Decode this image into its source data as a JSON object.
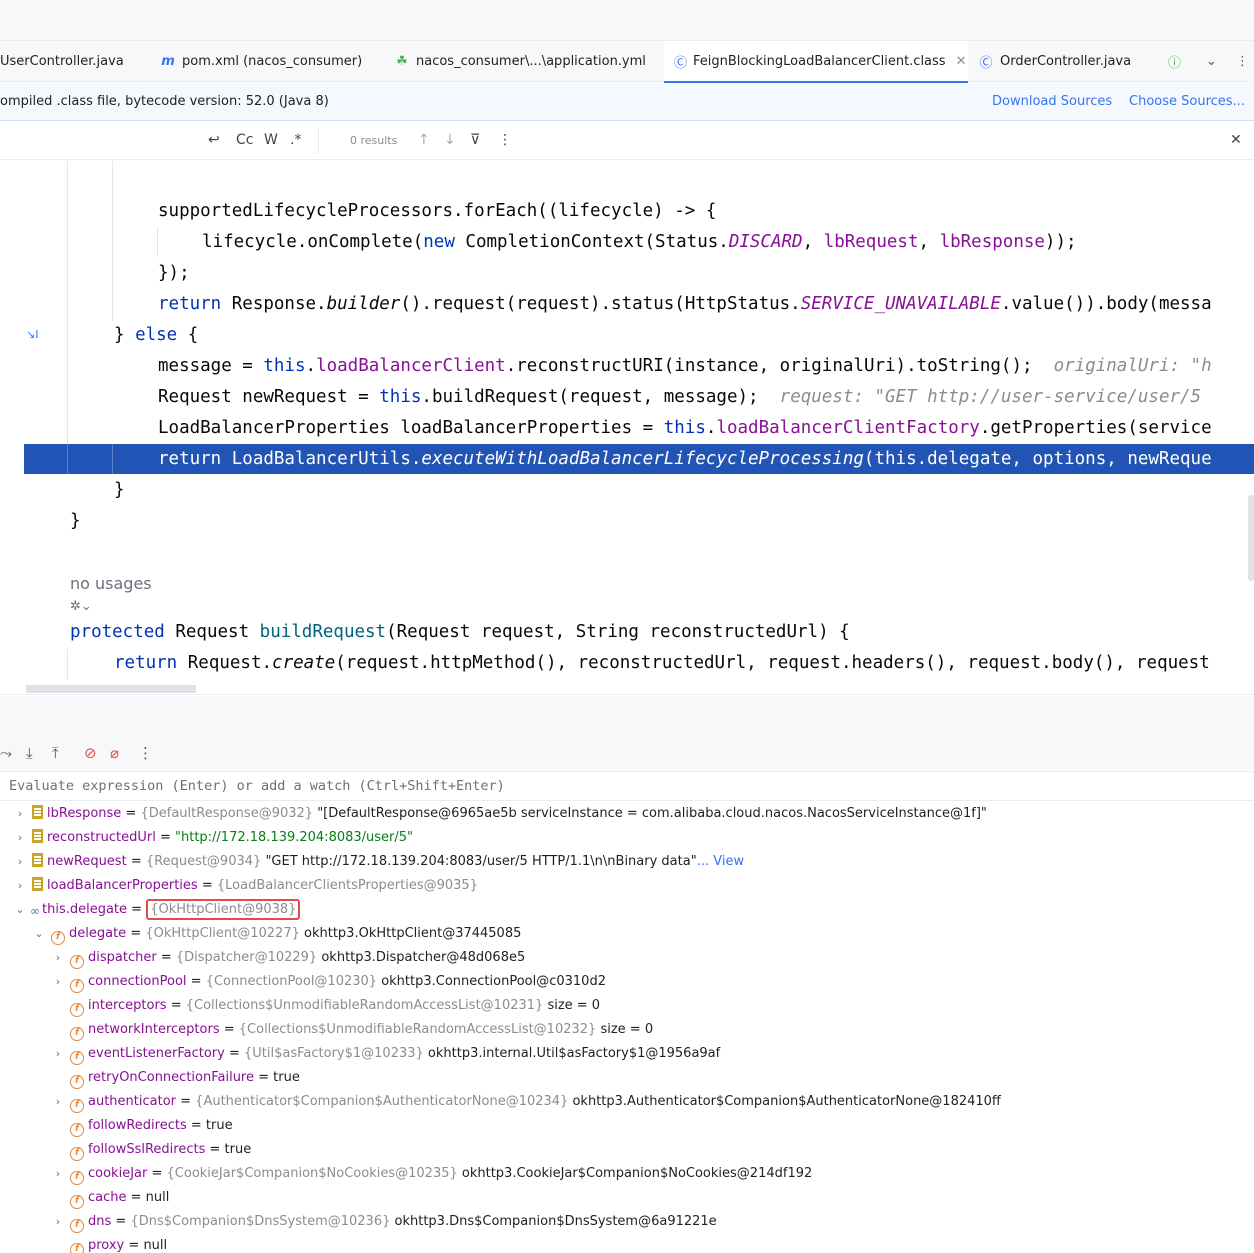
{
  "tabs": [
    {
      "label": "UserController.java",
      "icon": "java-class-icon"
    },
    {
      "label": "pom.xml (nacos_consumer)",
      "icon": "maven-icon"
    },
    {
      "label": "nacos_consumer\\...\\application.yml",
      "icon": "yaml-icon"
    },
    {
      "label": "FeignBlockingLoadBalancerClient.class",
      "icon": "class-icon",
      "active": true
    },
    {
      "label": "OrderController.java",
      "icon": "class-icon"
    }
  ],
  "notice": {
    "message": "ompiled .class file, bytecode version: 52.0 (Java 8)",
    "download_sources": "Download Sources",
    "choose_sources": "Choose Sources..."
  },
  "find": {
    "match_case": "Cc",
    "words": "W",
    "regex": ".*",
    "results": "0 results"
  },
  "code": {
    "l1_a": "supportedLifecycleProcessors.forEach((lifecycle) -> {",
    "l2_a": "lifecycle.onComplete(",
    "l2_new": "new",
    "l2_b": " CompletionContext(Status.",
    "l2_discard": "DISCARD",
    "l2_c": ", ",
    "l2_lbreq": "lbRequest",
    "l2_d": ", ",
    "l2_lbresp": "lbResponse",
    "l2_e": "));",
    "l3": "});",
    "l4_return": "return",
    "l4_a": " Response.",
    "l4_builder": "builder",
    "l4_b": "().request(request).status(HttpStatus.",
    "l4_su": "SERVICE_UNAVAILABLE",
    "l4_c": ".value()).body(messa",
    "l5_a": "} ",
    "l5_else": "else",
    "l5_b": " {",
    "l6_a": "message = ",
    "l6_this": "this",
    "l6_b": ".",
    "l6_lbc": "loadBalancerClient",
    "l6_c": ".reconstructURI(instance, originalUri).toString();",
    "l6_hint": "originalUri: \"h",
    "l7_a": "Request newRequest = ",
    "l7_this": "this",
    "l7_b": ".buildRequest(request, message);",
    "l7_hint": "request: \"GET http://user-service/user/5",
    "l8_a": "LoadBalancerProperties loadBalancerProperties = ",
    "l8_this": "this",
    "l8_b": ".",
    "l8_lbcf": "loadBalancerClientFactory",
    "l8_c": ".getProperties(service",
    "l9_return": "return",
    "l9_a": " LoadBalancerUtils.",
    "l9_exec": "executeWithLoadBalancerLifecycleProcessing",
    "l9_b": "(this.delegate, options, newReque",
    "l10": "}",
    "l11": "}",
    "no_usages": "no usages",
    "l12_protected": "protected",
    "l12_a": " Request ",
    "l12_build": "buildRequest",
    "l12_b": "(Request request, String reconstructedUrl) {",
    "l13_return": "return",
    "l13_a": " Request.",
    "l13_create": "create",
    "l13_b": "(request.httpMethod(), reconstructedUrl, request.headers(), request.body(), request"
  },
  "eval_placeholder": "Evaluate expression (Enter) or add a watch (Ctrl+Shift+Enter)",
  "variables": [
    {
      "indent": 0,
      "arrow": "›",
      "icon": "db",
      "name": "lbResponse",
      "type": "{DefaultResponse@9032}",
      "value": "\"[DefaultResponse@6965ae5b serviceInstance = com.alibaba.cloud.nacos.NacosServiceInstance@1f]\""
    },
    {
      "indent": 0,
      "arrow": "›",
      "icon": "db",
      "name": "reconstructedUrl",
      "type": "",
      "str": "\"http://172.18.139.204:8083/user/5\""
    },
    {
      "indent": 0,
      "arrow": "›",
      "icon": "db",
      "name": "newRequest",
      "type": "{Request@9034}",
      "value": "\"GET http://172.18.139.204:8083/user/5 HTTP/1.1\\n\\nBinary data\"",
      "link": "... View"
    },
    {
      "indent": 0,
      "arrow": "›",
      "icon": "db",
      "name": "loadBalancerProperties",
      "type": "{LoadBalancerClientsProperties@9035}",
      "value": ""
    },
    {
      "indent": 0,
      "arrow": "⌄",
      "icon": "oo",
      "name": "this.delegate",
      "boxed": "{OkHttpClient@9038}"
    },
    {
      "indent": 1,
      "arrow": "⌄",
      "icon": "f",
      "name": "delegate",
      "type": "{OkHttpClient@10227}",
      "value": "okhttp3.OkHttpClient@37445085"
    },
    {
      "indent": 2,
      "arrow": "›",
      "icon": "f",
      "name": "dispatcher",
      "type": "{Dispatcher@10229}",
      "value": "okhttp3.Dispatcher@48d068e5"
    },
    {
      "indent": 2,
      "arrow": "›",
      "icon": "f",
      "name": "connectionPool",
      "type": "{ConnectionPool@10230}",
      "value": "okhttp3.ConnectionPool@c0310d2"
    },
    {
      "indent": 2,
      "arrow": "",
      "icon": "f",
      "name": "interceptors",
      "type": "{Collections$UnmodifiableRandomAccessList@10231}",
      "value": " size = 0"
    },
    {
      "indent": 2,
      "arrow": "",
      "icon": "f",
      "name": "networkInterceptors",
      "type": "{Collections$UnmodifiableRandomAccessList@10232}",
      "value": " size = 0"
    },
    {
      "indent": 2,
      "arrow": "›",
      "icon": "f",
      "name": "eventListenerFactory",
      "type": "{Util$asFactory$1@10233}",
      "value": "okhttp3.internal.Util$asFactory$1@1956a9af"
    },
    {
      "indent": 2,
      "arrow": "",
      "icon": "f",
      "name": "retryOnConnectionFailure",
      "type": "",
      "value": "true"
    },
    {
      "indent": 2,
      "arrow": "›",
      "icon": "f",
      "name": "authenticator",
      "type": "{Authenticator$Companion$AuthenticatorNone@10234}",
      "value": "okhttp3.Authenticator$Companion$AuthenticatorNone@182410ff"
    },
    {
      "indent": 2,
      "arrow": "",
      "icon": "f",
      "name": "followRedirects",
      "type": "",
      "value": "true"
    },
    {
      "indent": 2,
      "arrow": "",
      "icon": "f",
      "name": "followSslRedirects",
      "type": "",
      "value": "true"
    },
    {
      "indent": 2,
      "arrow": "›",
      "icon": "f",
      "name": "cookieJar",
      "type": "{CookieJar$Companion$NoCookies@10235}",
      "value": "okhttp3.CookieJar$Companion$NoCookies@214df192"
    },
    {
      "indent": 2,
      "arrow": "",
      "icon": "f",
      "name": "cache",
      "type": "",
      "value": "null"
    },
    {
      "indent": 2,
      "arrow": "›",
      "icon": "f",
      "name": "dns",
      "type": "{Dns$Companion$DnsSystem@10236}",
      "value": "okhttp3.Dns$Companion$DnsSystem@6a91221e"
    },
    {
      "indent": 2,
      "arrow": "",
      "icon": "f",
      "name": "proxy",
      "type": "",
      "value": "null"
    }
  ],
  "colors": {
    "accent": "#3574f0",
    "keyword": "#0033b3",
    "field": "#871094",
    "highlight": "#2154b4",
    "redbox": "#e5484d"
  }
}
